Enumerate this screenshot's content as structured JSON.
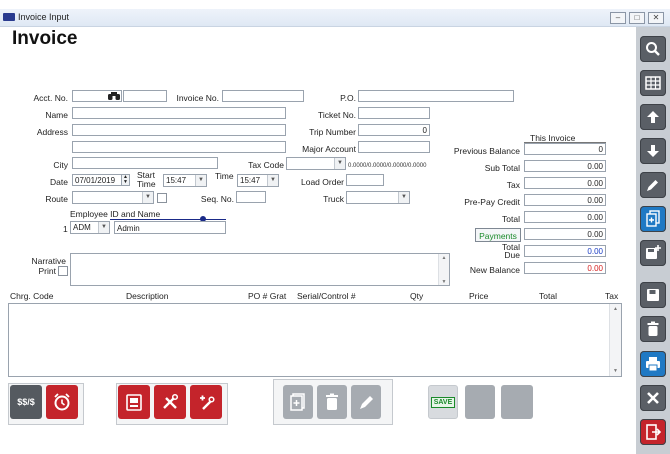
{
  "window": {
    "title": "Invoice Input",
    "min": "–",
    "max": "□",
    "close": "✕"
  },
  "page": {
    "heading": "Invoice"
  },
  "fields": {
    "acct_no_label": "Acct. No.",
    "invoice_no_label": "Invoice No.",
    "po_label": "P.O.",
    "name_label": "Name",
    "ticket_no_label": "Ticket No.",
    "address_label": "Address",
    "trip_number_label": "Trip Number",
    "trip_number_value": "0",
    "major_account_label": "Major Account",
    "city_label": "City",
    "tax_code_label": "Tax Code",
    "tax_code_rates": "0.0000/0.0000/0.0000/0.0000",
    "date_label": "Date",
    "date_value": "07/01/2019",
    "start_time_label": "Start Time",
    "start_time_value": "15:47",
    "time_label": "Time",
    "time_value": "15:47",
    "load_order_label": "Load Order",
    "route_label": "Route",
    "seq_no_label": "Seq. No.",
    "truck_label": "Truck",
    "employee_label": "Employee ID and Name",
    "employee_index": "1",
    "employee_id": "ADM",
    "employee_name": "Admin",
    "narrative_label": "Narrative",
    "print_label": "Print"
  },
  "totals": {
    "this_invoice_label": "This Invoice",
    "previous_balance_label": "Previous Balance",
    "previous_balance_value": "0",
    "sub_total_label": "Sub Total",
    "sub_total_value": "0.00",
    "tax_label": "Tax",
    "tax_value": "0.00",
    "prepay_credit_label": "Pre-Pay Credit",
    "prepay_credit_value": "0.00",
    "total_label": "Total",
    "total_value": "0.00",
    "payments_label": "Payments",
    "payments_value": "0.00",
    "total_due_label_1": "Total",
    "total_due_label_2": "Due",
    "total_due_value": "0.00",
    "new_balance_label": "New Balance",
    "new_balance_value": "0.00"
  },
  "grid": {
    "columns": [
      "Chrg. Code",
      "Description",
      "PO # Grat",
      "Serial/Control #",
      "Qty",
      "Price",
      "Total",
      "Tax"
    ]
  },
  "toolbar": {
    "money_label": "$$/$",
    "save_label": "SAVE"
  },
  "colors": {
    "accent_blue": "#1f79c4",
    "accent_red": "#c4242b",
    "dark_button": "#555a60",
    "payments_green": "#1a8a2a",
    "total_due_blue": "#1a3cc4",
    "new_balance_red": "#d42020"
  }
}
